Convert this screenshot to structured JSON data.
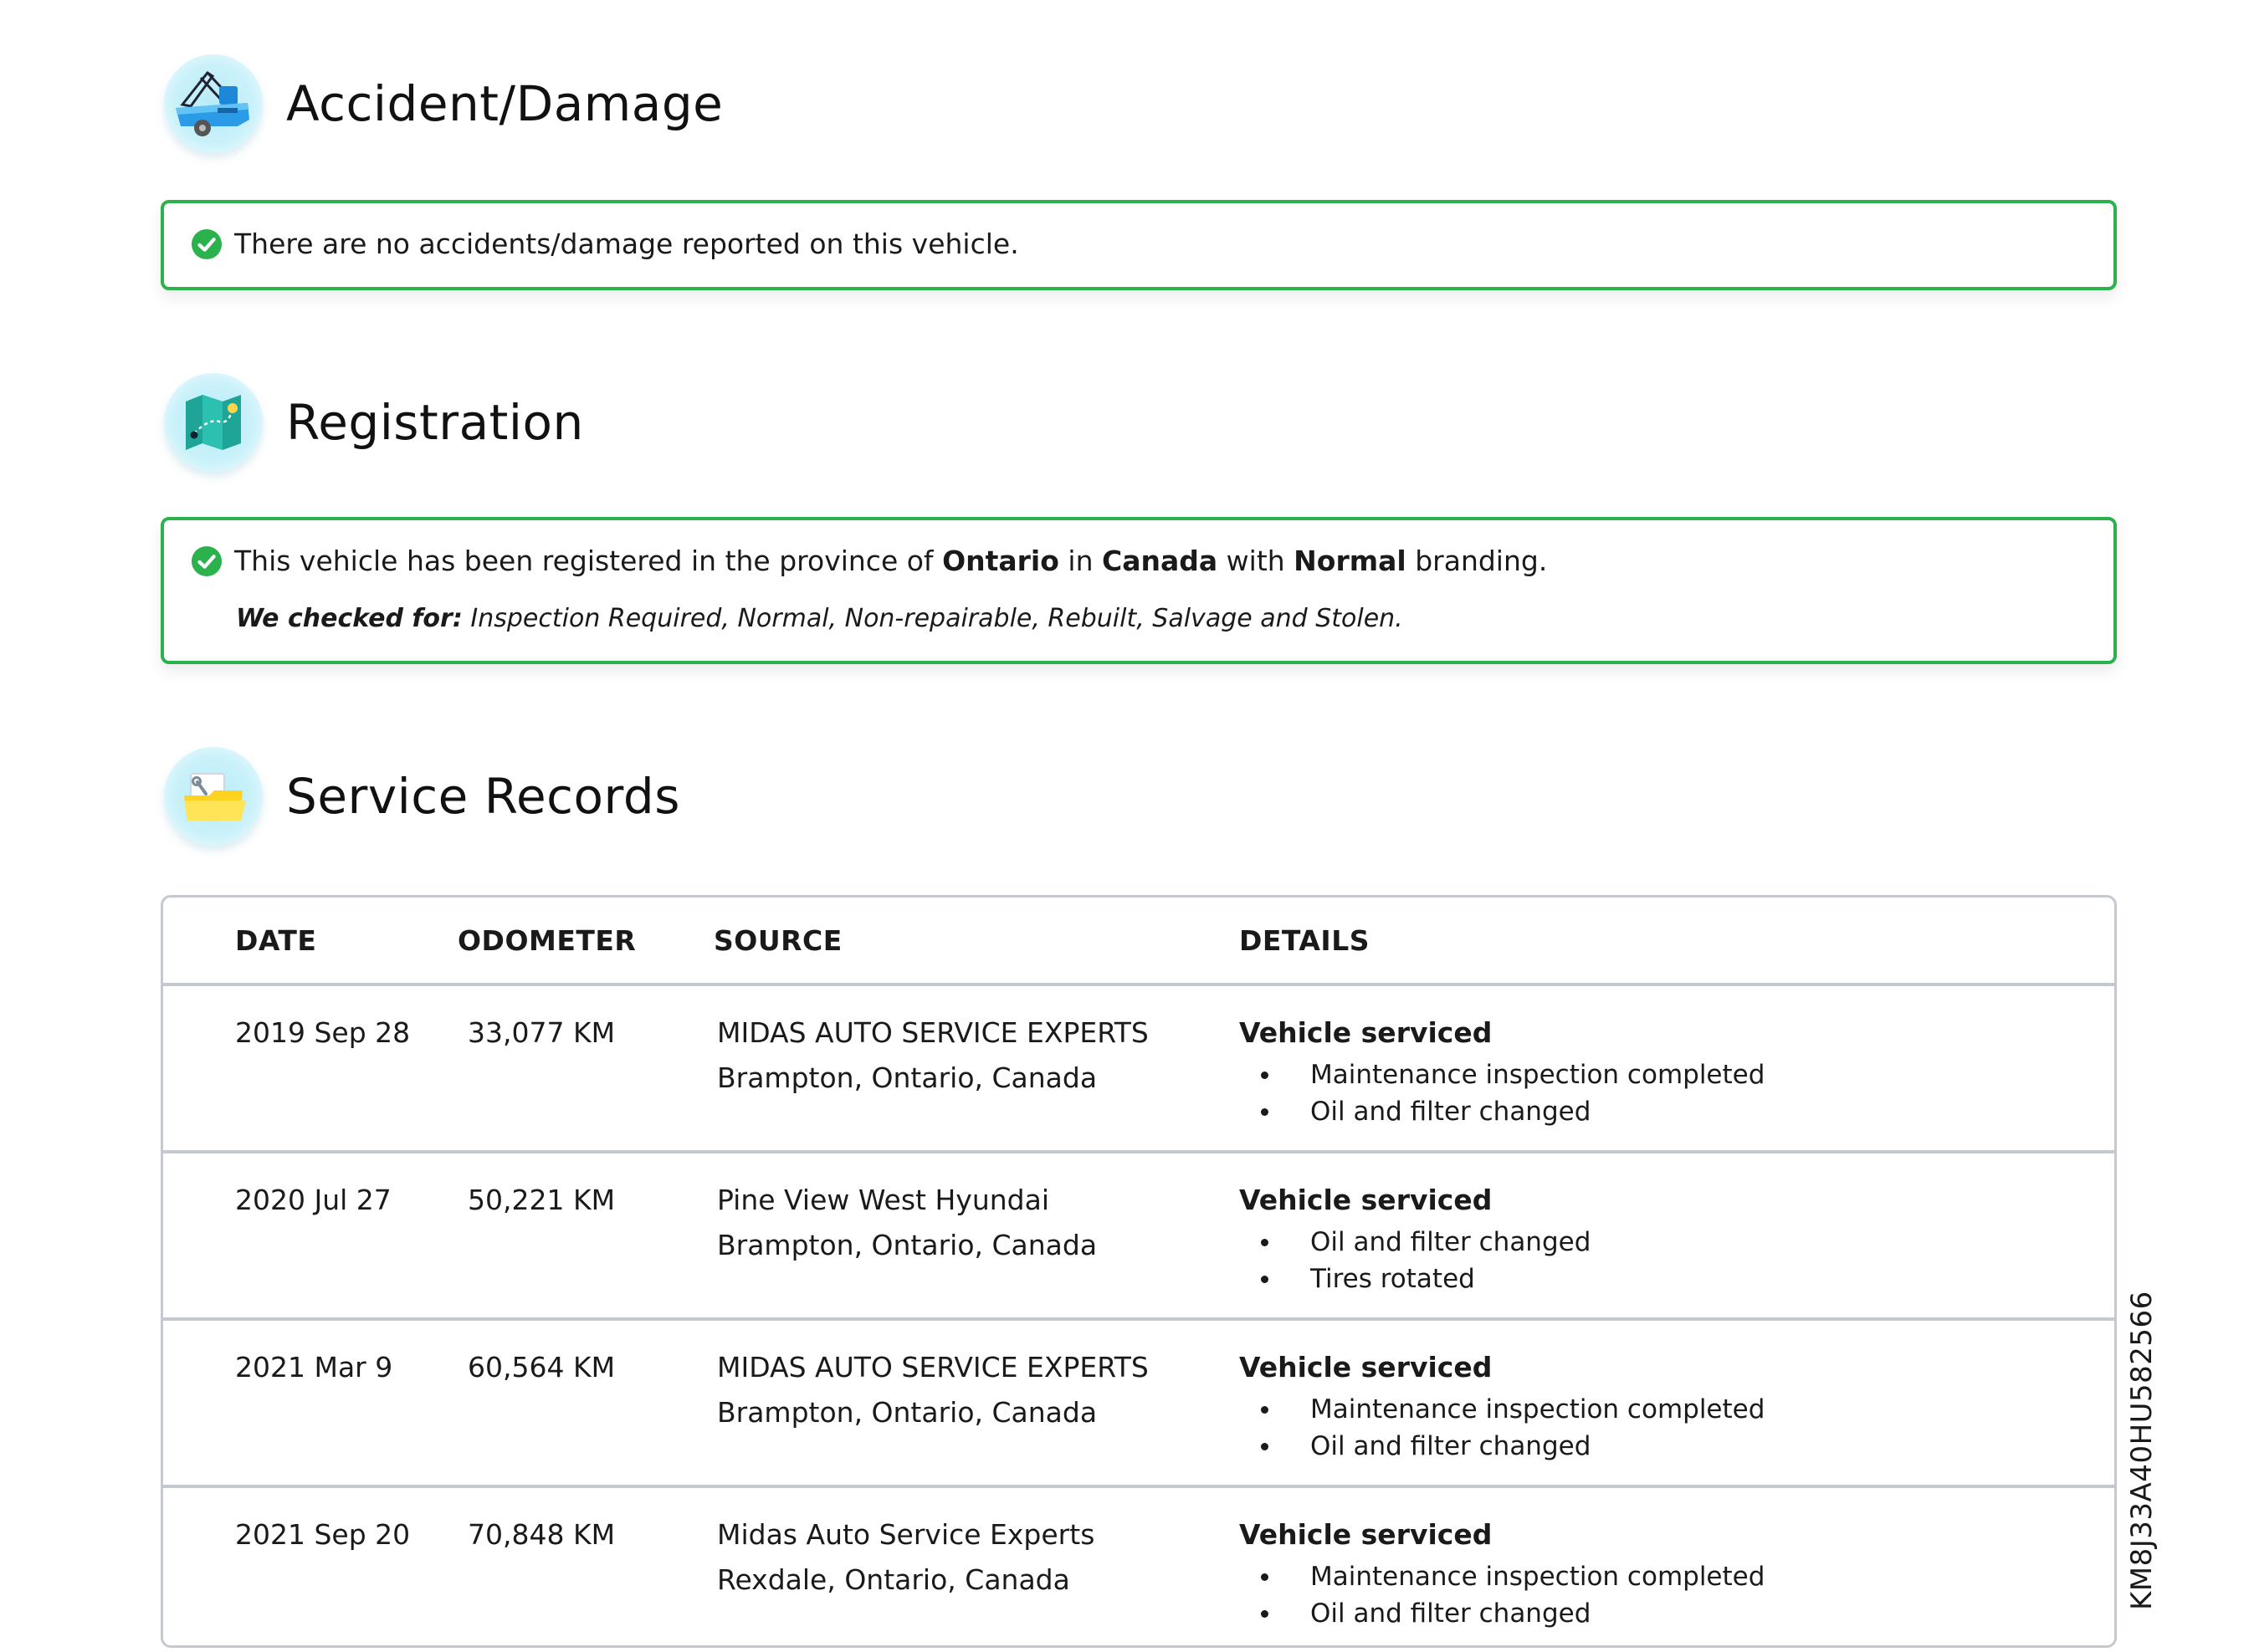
{
  "sections": {
    "accident": {
      "title": "Accident/Damage",
      "icon": "tow-truck-icon",
      "message": "There are no accidents/damage reported on this vehicle."
    },
    "registration": {
      "title": "Registration",
      "icon": "map-icon",
      "message_prefix": "This vehicle has been registered in the province of",
      "province": "Ontario",
      "word_in": "in",
      "country": "Canada",
      "word_with": "with",
      "branding": "Normal",
      "message_suffix": "branding.",
      "checked_for_label": "We checked for:",
      "checked_for_values": "Inspection Required, Normal, Non-repairable, Rebuilt, Salvage and Stolen."
    },
    "service": {
      "title": "Service Records",
      "icon": "folder-wrench-icon",
      "columns": {
        "date": "DATE",
        "odometer": "ODOMETER",
        "source": "SOURCE",
        "details": "DETAILS"
      },
      "records": [
        {
          "date": "2019 Sep 28",
          "odometer": "33,077 KM",
          "source_name": "MIDAS AUTO SERVICE EXPERTS",
          "source_location": "Brampton, Ontario, Canada",
          "detail_title": "Vehicle serviced",
          "items": [
            "Maintenance inspection completed",
            "Oil and filter changed"
          ]
        },
        {
          "date": "2020 Jul 27",
          "odometer": "50,221 KM",
          "source_name": "Pine View West Hyundai",
          "source_location": "Brampton, Ontario, Canada",
          "detail_title": "Vehicle serviced",
          "items": [
            "Oil and filter changed",
            "Tires rotated"
          ]
        },
        {
          "date": "2021 Mar 9",
          "odometer": "60,564 KM",
          "source_name": "MIDAS AUTO SERVICE EXPERTS",
          "source_location": "Brampton, Ontario, Canada",
          "detail_title": "Vehicle serviced",
          "items": [
            "Maintenance inspection completed",
            "Oil and filter changed"
          ]
        },
        {
          "date": "2021 Sep 20",
          "odometer": "70,848 KM",
          "source_name": "Midas Auto Service Experts",
          "source_location": "Rexdale, Ontario, Canada",
          "detail_title": "Vehicle serviced",
          "items": [
            "Maintenance inspection completed",
            "Oil and filter changed"
          ]
        }
      ]
    }
  },
  "vin": "KM8J33A40HU582566",
  "colors": {
    "success_green": "#2bb24c",
    "border_gray": "#c4c9cf",
    "icon_bg": "#c9f1fa"
  }
}
